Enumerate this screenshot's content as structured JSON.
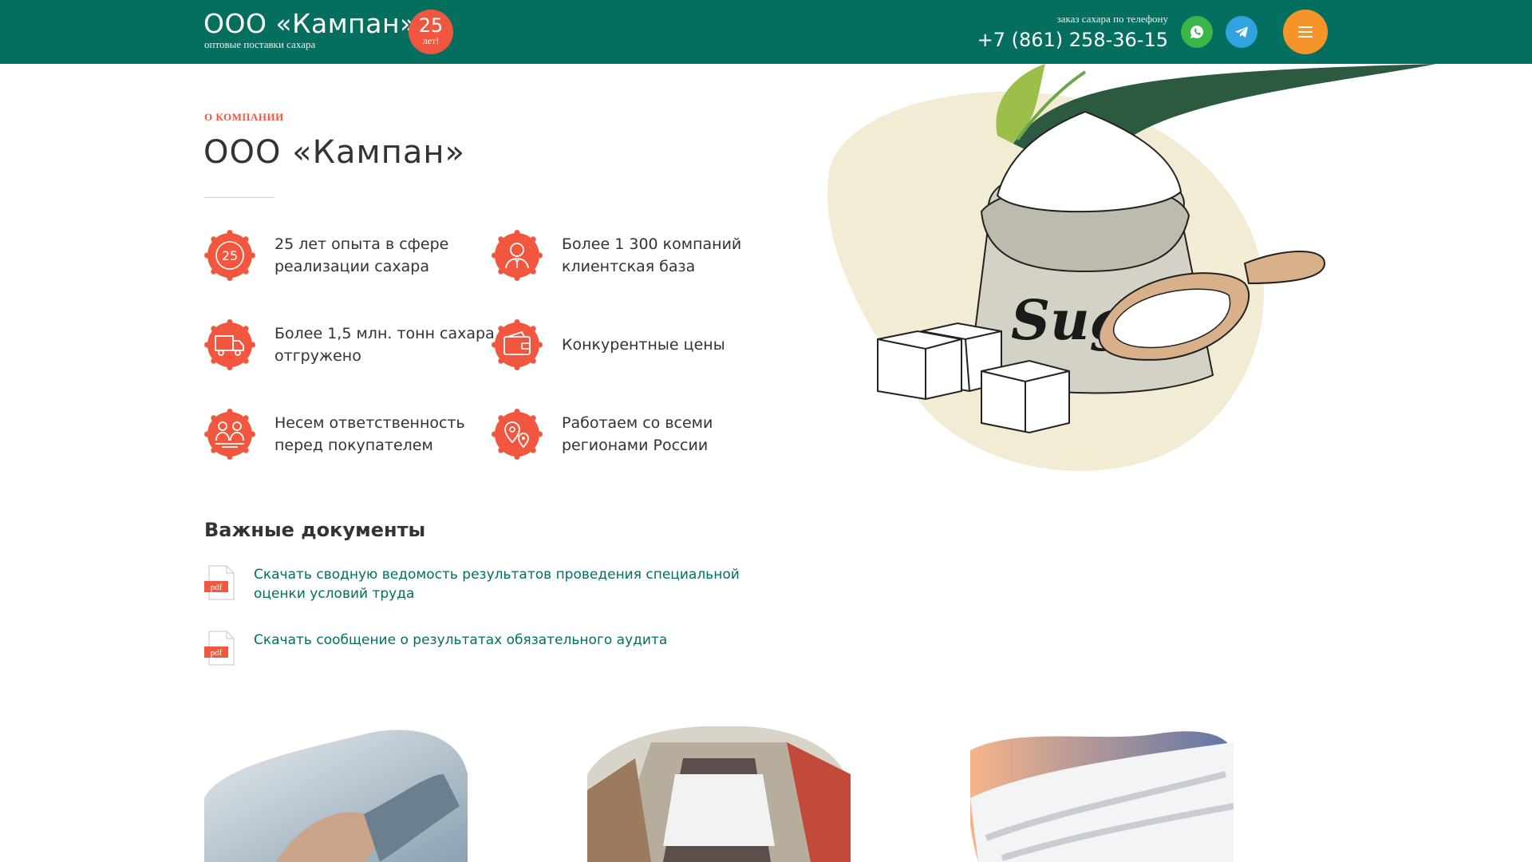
{
  "header": {
    "logo_title": "ООО «Кампан»",
    "logo_subtitle": "оптовые поставки сахара",
    "badge_number": "25",
    "badge_text": "лет!",
    "phone_label": "заказ сахара по телефону",
    "phone": "+7 (861) 258-36-15",
    "whatsapp_icon": "whatsapp-icon",
    "telegram_icon": "telegram-icon",
    "menu_icon": "hamburger-icon"
  },
  "about": {
    "eyebrow": "О КОМПАНИИ",
    "title": "ООО «Кампан»",
    "features": [
      {
        "icon": "badge-25-icon",
        "text": "25 лет опыта в сфере реализации сахара"
      },
      {
        "icon": "client-icon",
        "text": "Более 1 300 компаний клиентская база"
      },
      {
        "icon": "truck-icon",
        "text": "Более 1,5 млн. тонн сахара отгружено"
      },
      {
        "icon": "wallet-icon",
        "text": "Конкурентные цены"
      },
      {
        "icon": "handshake-people-icon",
        "text": "Несем ответственность перед покупателем"
      },
      {
        "icon": "map-pins-icon",
        "text": "Работаем со всеми регионами России"
      }
    ]
  },
  "documents": {
    "title": "Важные документы",
    "file_badge": "pdf",
    "items": [
      {
        "label": "Скачать сводную ведомость результатов проведения специальной оценки условий труда"
      },
      {
        "label": "Скачать сообщение о результатах обязательного аудита"
      }
    ]
  },
  "hero": {
    "bag_text": "Sugar"
  },
  "colors": {
    "header_bg": "#046f5f",
    "accent_red": "#f1573f",
    "accent_orange": "#f4942a",
    "link_green": "#046f5f",
    "whatsapp": "#3bb54a",
    "telegram": "#2fa4df",
    "blob": "#f2ecd4"
  }
}
